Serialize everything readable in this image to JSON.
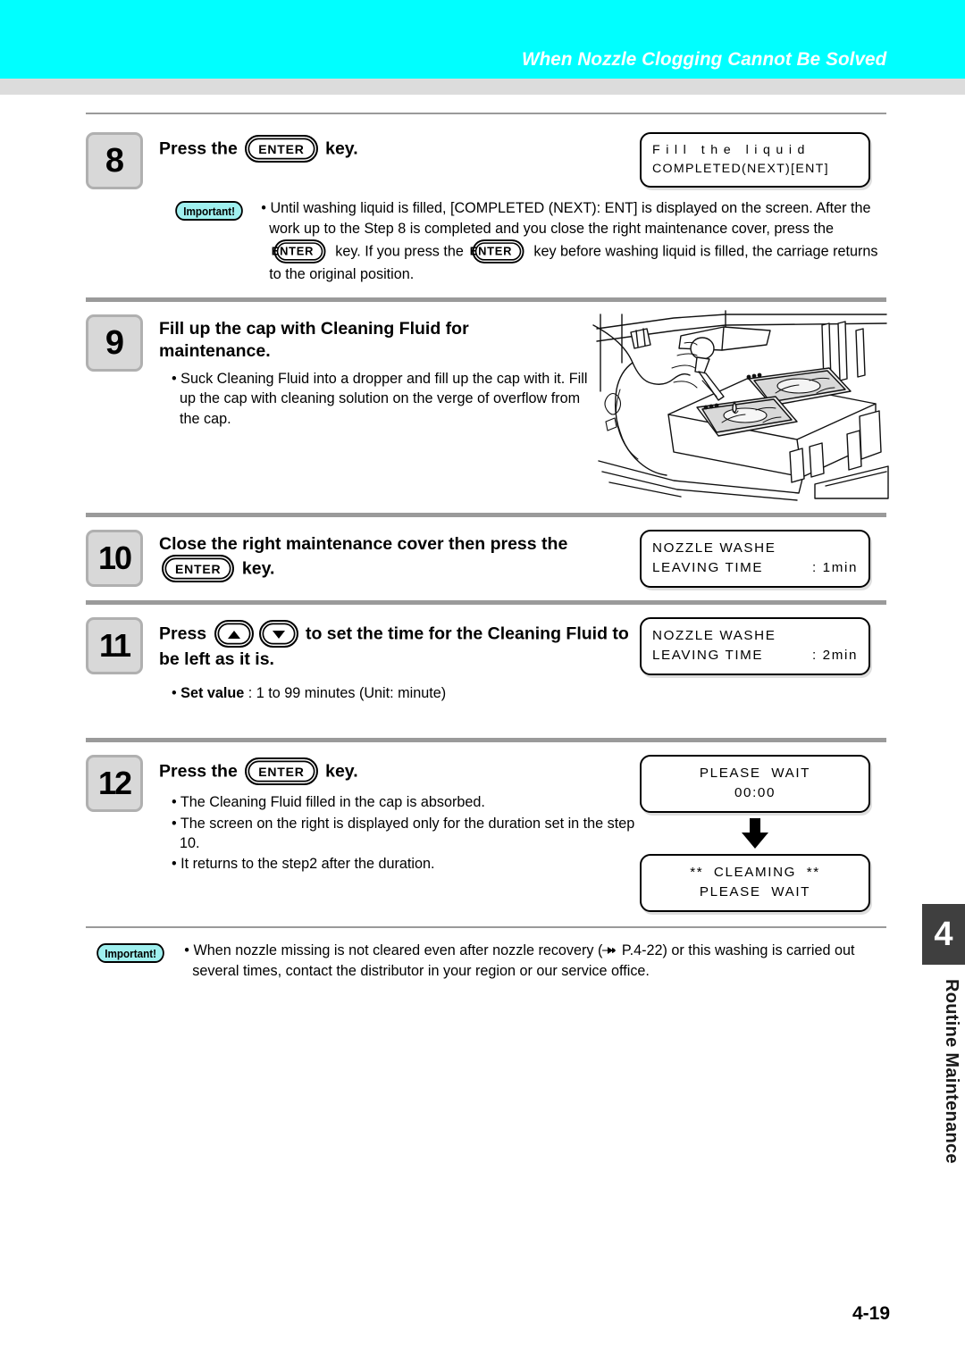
{
  "header": {
    "title": "When Nozzle Clogging Cannot Be Solved",
    "band_color": "#00ffff",
    "title_color": "#ffffff"
  },
  "keys": {
    "enter": "ENTER",
    "up": "up-arrow",
    "down": "down-arrow"
  },
  "badges": {
    "important": "Important!",
    "important_color": "#9ff0ef"
  },
  "steps": [
    {
      "number": "8",
      "heading_pre": "Press the",
      "heading_post": "key.",
      "lcd": {
        "line1": "F i l l   t h e   l i q u i d",
        "line2": "COMPLETED(NEXT)[ENT]"
      },
      "note": "Until washing liquid is filled, [COMPLETED (NEXT): ENT] is displayed on the screen. After the work up to the Step 8 is completed and you close the right maintenance cover, press the",
      "note_mid": "key. If you press the",
      "note_end": "key before washing liquid is filled, the carriage returns to the original position."
    },
    {
      "number": "9",
      "heading": "Fill up the cap with Cleaning Fluid for maintenance.",
      "bullets": [
        "Suck Cleaning Fluid into a dropper and fill up the cap with it. Fill up the cap with cleaning solution on the verge of overflow from the cap."
      ],
      "illustration": "printer-cap-dropper-illustration"
    },
    {
      "number": "10",
      "heading_pre": "Close the right maintenance cover then press the",
      "heading_post": "key.",
      "lcd": {
        "line1": "NOZZLE WASHE",
        "line2": "LEAVING TIME",
        "line2_value": ": 1min"
      }
    },
    {
      "number": "11",
      "heading_pre": "Press",
      "heading_post": "to set the time for the Cleaning Fluid to be left as it is.",
      "bullet_label": "Set value",
      "bullet_sep": ":",
      "bullet_value": "1 to 99 minutes (Unit: minute)",
      "lcd": {
        "line1": "NOZZLE WASHE",
        "line2": "LEAVING TIME",
        "line2_value": ": 2min"
      }
    },
    {
      "number": "12",
      "heading_pre": "Press the",
      "heading_post": "key.",
      "bullets": [
        "The Cleaning Fluid filled in the cap is absorbed.",
        "The screen on the right is displayed only for the duration set in the step 10.",
        "It returns to the step2 after the duration."
      ],
      "lcd1": {
        "line1": "PLEASE  WAIT",
        "line2": "00:00"
      },
      "lcd2": {
        "line1": "**  CLEAMING  **",
        "line2": "PLEASE  WAIT"
      }
    }
  ],
  "footer_note": {
    "text_pre": "When nozzle missing is not cleared even after nozzle recovery (",
    "reference": "P.4-22",
    "text_post": ") or this washing is carried out several times, contact the distributor in your region or our service office."
  },
  "side_tab": {
    "number": "4",
    "label": "Routine Maintenance",
    "color": "#3f3f3f"
  },
  "page_number": "4-19"
}
